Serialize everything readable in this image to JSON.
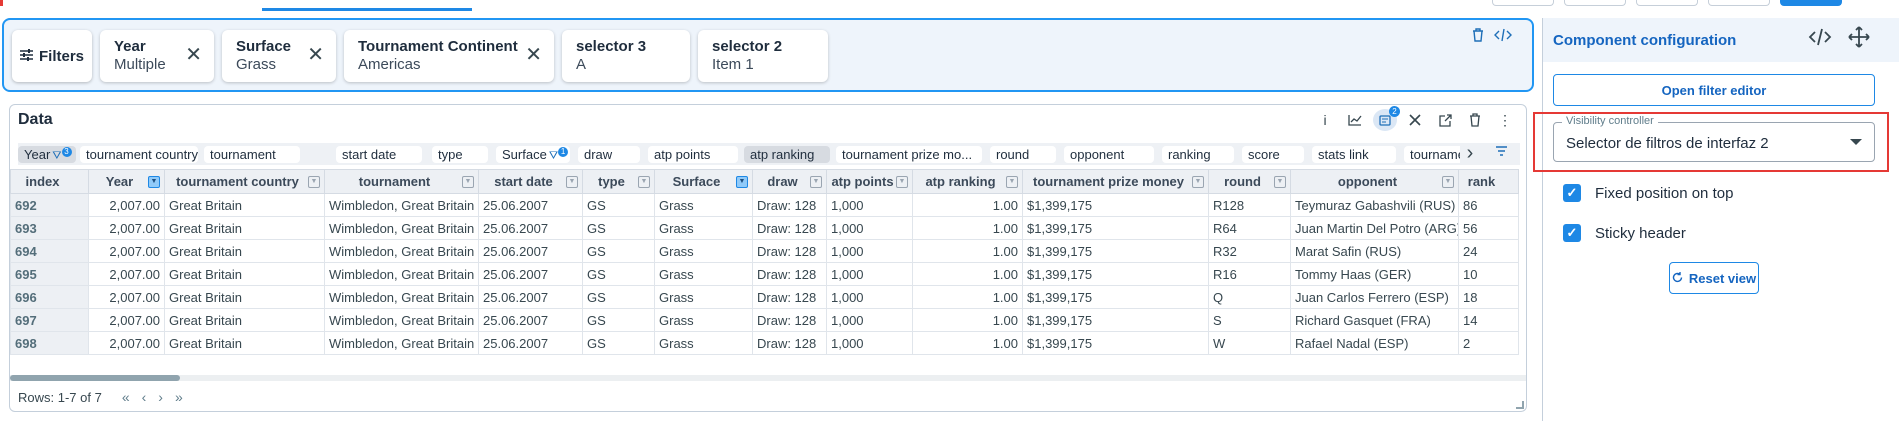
{
  "filter_bar": {
    "filters_label": "Filters",
    "chips": [
      {
        "title": "Year",
        "value": "Multiple",
        "closable": true
      },
      {
        "title": "Surface",
        "value": "Grass",
        "closable": true
      },
      {
        "title": "Tournament Continent",
        "value": "Americas",
        "closable": true
      },
      {
        "title": "selector 3",
        "value": "A",
        "closable": false
      },
      {
        "title": "selector 2",
        "value": "Item 1",
        "closable": false
      }
    ]
  },
  "data_panel": {
    "title": "Data",
    "toolbar_badge": "2",
    "column_pills": [
      {
        "label": "Year",
        "dark": true,
        "filter": true,
        "badge": "3"
      },
      {
        "label": "tournament country"
      },
      {
        "label": "tournament"
      },
      {
        "label": "start date"
      },
      {
        "label": "type"
      },
      {
        "label": "Surface",
        "filter": true,
        "badge": "1"
      },
      {
        "label": "draw"
      },
      {
        "label": "atp points"
      },
      {
        "label": "atp ranking",
        "dark": true
      },
      {
        "label": "tournament prize mo..."
      },
      {
        "label": "round"
      },
      {
        "label": "opponent"
      },
      {
        "label": "ranking"
      },
      {
        "label": "score"
      },
      {
        "label": "stats link"
      },
      {
        "label": "tourname"
      }
    ],
    "columns": [
      "index",
      "Year",
      "tournament country",
      "tournament",
      "start date",
      "type",
      "Surface",
      "draw",
      "atp points",
      "atp ranking",
      "tournament prize money",
      "round",
      "opponent",
      "rank"
    ],
    "rows": [
      [
        "692",
        "2,007.00",
        "Great Britain",
        "Wimbledon, Great Britain",
        "25.06.2007",
        "GS",
        "Grass",
        "Draw: 128",
        "1,000",
        "1.00",
        "$1,399,175",
        "R128",
        "Teymuraz Gabashvili (RUS)",
        "86"
      ],
      [
        "693",
        "2,007.00",
        "Great Britain",
        "Wimbledon, Great Britain",
        "25.06.2007",
        "GS",
        "Grass",
        "Draw: 128",
        "1,000",
        "1.00",
        "$1,399,175",
        "R64",
        "Juan Martin Del Potro (ARG)",
        "56"
      ],
      [
        "694",
        "2,007.00",
        "Great Britain",
        "Wimbledon, Great Britain",
        "25.06.2007",
        "GS",
        "Grass",
        "Draw: 128",
        "1,000",
        "1.00",
        "$1,399,175",
        "R32",
        "Marat Safin (RUS)",
        "24"
      ],
      [
        "695",
        "2,007.00",
        "Great Britain",
        "Wimbledon, Great Britain",
        "25.06.2007",
        "GS",
        "Grass",
        "Draw: 128",
        "1,000",
        "1.00",
        "$1,399,175",
        "R16",
        "Tommy Haas (GER)",
        "10"
      ],
      [
        "696",
        "2,007.00",
        "Great Britain",
        "Wimbledon, Great Britain",
        "25.06.2007",
        "GS",
        "Grass",
        "Draw: 128",
        "1,000",
        "1.00",
        "$1,399,175",
        "Q",
        "Juan Carlos Ferrero (ESP)",
        "18"
      ],
      [
        "697",
        "2,007.00",
        "Great Britain",
        "Wimbledon, Great Britain",
        "25.06.2007",
        "GS",
        "Grass",
        "Draw: 128",
        "1,000",
        "1.00",
        "$1,399,175",
        "S",
        "Richard Gasquet (FRA)",
        "14"
      ],
      [
        "698",
        "2,007.00",
        "Great Britain",
        "Wimbledon, Great Britain",
        "25.06.2007",
        "GS",
        "Grass",
        "Draw: 128",
        "1,000",
        "1.00",
        "$1,399,175",
        "W",
        "Rafael Nadal (ESP)",
        "2"
      ]
    ],
    "rows_info": "Rows: 1-7 of 7"
  },
  "config": {
    "title": "Component configuration",
    "open_filter_editor": "Open filter editor",
    "visibility_label": "Visibility controller",
    "visibility_value": "Selector de filtros de interfaz 2",
    "fixed_position": "Fixed position on top",
    "sticky_header": "Sticky header",
    "reset_view": "Reset view"
  },
  "colors": {
    "accent": "#1e88e5",
    "highlight": "#e53935",
    "panel_bg": "#eef4fb"
  }
}
